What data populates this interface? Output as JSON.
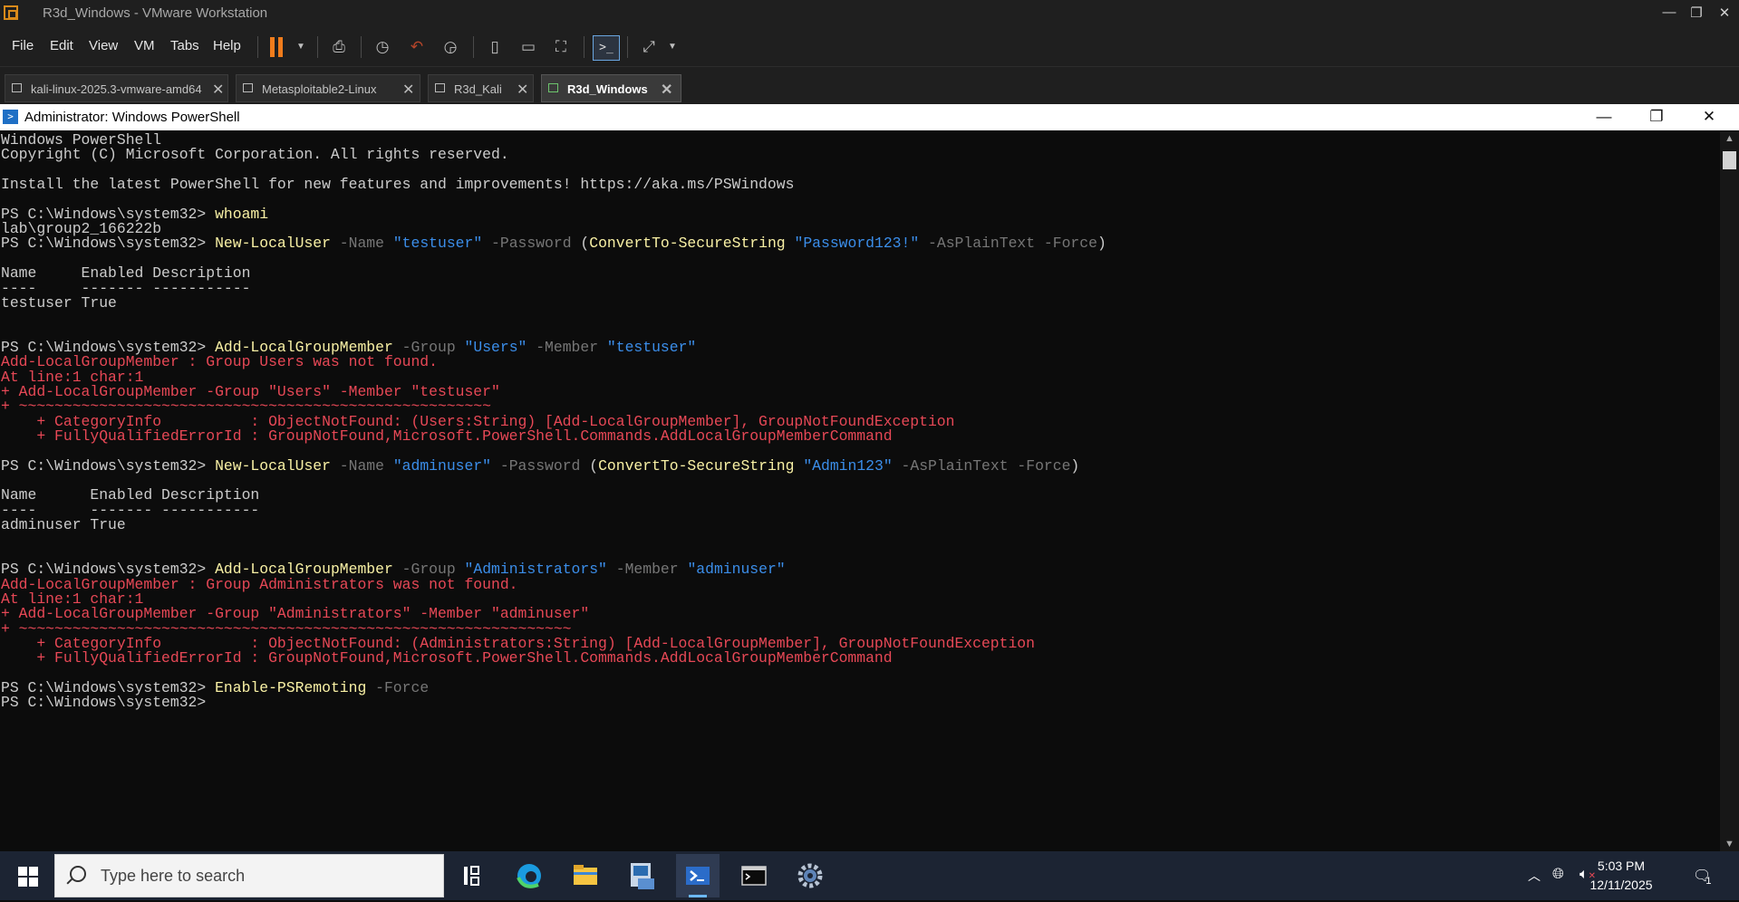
{
  "vmware": {
    "title": "R3d_Windows - VMware Workstation",
    "menu": [
      "File",
      "Edit",
      "View",
      "VM",
      "Tabs",
      "Help"
    ],
    "tabs": [
      {
        "label": "kali-linux-2025.3-vmware-amd64"
      },
      {
        "label": "Metasploitable2-Linux"
      },
      {
        "label": "R3d_Kali"
      },
      {
        "label": "R3d_Windows"
      }
    ],
    "close_glyph": "✕"
  },
  "powershell": {
    "title": "Administrator: Windows PowerShell",
    "lines": [
      [
        {
          "t": "Windows PowerShell",
          "c": "w"
        }
      ],
      [
        {
          "t": "Copyright (C) Microsoft Corporation. All rights reserved.",
          "c": "w"
        }
      ],
      [],
      [
        {
          "t": "Install the latest PowerShell for new features and improvements! https://aka.ms/PSWindows",
          "c": "w"
        }
      ],
      [],
      [
        {
          "t": "PS C:\\Windows\\system32> ",
          "c": "w"
        },
        {
          "t": "whoami",
          "c": "y"
        }
      ],
      [
        {
          "t": "lab\\group2_166222b",
          "c": "w"
        }
      ],
      [
        {
          "t": "PS C:\\Windows\\system32> ",
          "c": "w"
        },
        {
          "t": "New-LocalUser",
          "c": "y"
        },
        {
          "t": " -Name ",
          "c": "g"
        },
        {
          "t": "\"testuser\"",
          "c": "b"
        },
        {
          "t": " -Password ",
          "c": "g"
        },
        {
          "t": "(",
          "c": "w"
        },
        {
          "t": "ConvertTo-SecureString",
          "c": "y"
        },
        {
          "t": " ",
          "c": "w"
        },
        {
          "t": "\"Password123!\"",
          "c": "b"
        },
        {
          "t": " -AsPlainText -Force",
          "c": "g"
        },
        {
          "t": ")",
          "c": "w"
        }
      ],
      [],
      [
        {
          "t": "Name     Enabled Description",
          "c": "w"
        }
      ],
      [
        {
          "t": "----     ------- -----------",
          "c": "w"
        }
      ],
      [
        {
          "t": "testuser True",
          "c": "w"
        }
      ],
      [],
      [],
      [
        {
          "t": "PS C:\\Windows\\system32> ",
          "c": "w"
        },
        {
          "t": "Add-LocalGroupMember",
          "c": "y"
        },
        {
          "t": " -Group ",
          "c": "g"
        },
        {
          "t": "\"Users\"",
          "c": "b"
        },
        {
          "t": " -Member ",
          "c": "g"
        },
        {
          "t": "\"testuser\"",
          "c": "b"
        }
      ],
      [
        {
          "t": "Add-LocalGroupMember : Group Users was not found.",
          "c": "r"
        }
      ],
      [
        {
          "t": "At line:1 char:1",
          "c": "r"
        }
      ],
      [
        {
          "t": "+ Add-LocalGroupMember -Group \"Users\" -Member \"testuser\"",
          "c": "r"
        }
      ],
      [
        {
          "t": "+ ~~~~~~~~~~~~~~~~~~~~~~~~~~~~~~~~~~~~~~~~~~~~~~~~~~~~~",
          "c": "r"
        }
      ],
      [
        {
          "t": "    + CategoryInfo          : ObjectNotFound: (Users:String) [Add-LocalGroupMember], GroupNotFoundException",
          "c": "r"
        }
      ],
      [
        {
          "t": "    + FullyQualifiedErrorId : GroupNotFound,Microsoft.PowerShell.Commands.AddLocalGroupMemberCommand",
          "c": "r"
        }
      ],
      [],
      [
        {
          "t": "PS C:\\Windows\\system32> ",
          "c": "w"
        },
        {
          "t": "New-LocalUser",
          "c": "y"
        },
        {
          "t": " -Name ",
          "c": "g"
        },
        {
          "t": "\"adminuser\"",
          "c": "b"
        },
        {
          "t": " -Password ",
          "c": "g"
        },
        {
          "t": "(",
          "c": "w"
        },
        {
          "t": "ConvertTo-SecureString",
          "c": "y"
        },
        {
          "t": " ",
          "c": "w"
        },
        {
          "t": "\"Admin123\"",
          "c": "b"
        },
        {
          "t": " -AsPlainText -Force",
          "c": "g"
        },
        {
          "t": ")",
          "c": "w"
        }
      ],
      [],
      [
        {
          "t": "Name      Enabled Description",
          "c": "w"
        }
      ],
      [
        {
          "t": "----      ------- -----------",
          "c": "w"
        }
      ],
      [
        {
          "t": "adminuser True",
          "c": "w"
        }
      ],
      [],
      [],
      [
        {
          "t": "PS C:\\Windows\\system32> ",
          "c": "w"
        },
        {
          "t": "Add-LocalGroupMember",
          "c": "y"
        },
        {
          "t": " -Group ",
          "c": "g"
        },
        {
          "t": "\"Administrators\"",
          "c": "b"
        },
        {
          "t": " -Member ",
          "c": "g"
        },
        {
          "t": "\"adminuser\"",
          "c": "b"
        }
      ],
      [
        {
          "t": "Add-LocalGroupMember : Group Administrators was not found.",
          "c": "r"
        }
      ],
      [
        {
          "t": "At line:1 char:1",
          "c": "r"
        }
      ],
      [
        {
          "t": "+ Add-LocalGroupMember -Group \"Administrators\" -Member \"adminuser\"",
          "c": "r"
        }
      ],
      [
        {
          "t": "+ ~~~~~~~~~~~~~~~~~~~~~~~~~~~~~~~~~~~~~~~~~~~~~~~~~~~~~~~~~~~~~~",
          "c": "r"
        }
      ],
      [
        {
          "t": "    + CategoryInfo          : ObjectNotFound: (Administrators:String) [Add-LocalGroupMember], GroupNotFoundException",
          "c": "r"
        }
      ],
      [
        {
          "t": "    + FullyQualifiedErrorId : GroupNotFound,Microsoft.PowerShell.Commands.AddLocalGroupMemberCommand",
          "c": "r"
        }
      ],
      [],
      [
        {
          "t": "PS C:\\Windows\\system32> ",
          "c": "w"
        },
        {
          "t": "Enable-PSRemoting",
          "c": "y"
        },
        {
          "t": " -Force",
          "c": "g"
        }
      ],
      [
        {
          "t": "PS C:\\Windows\\system32> ",
          "c": "w"
        }
      ]
    ]
  },
  "taskbar": {
    "search_placeholder": "Type here to search",
    "time": "5:03 PM",
    "date": "12/11/2025",
    "notification_count": "1"
  }
}
